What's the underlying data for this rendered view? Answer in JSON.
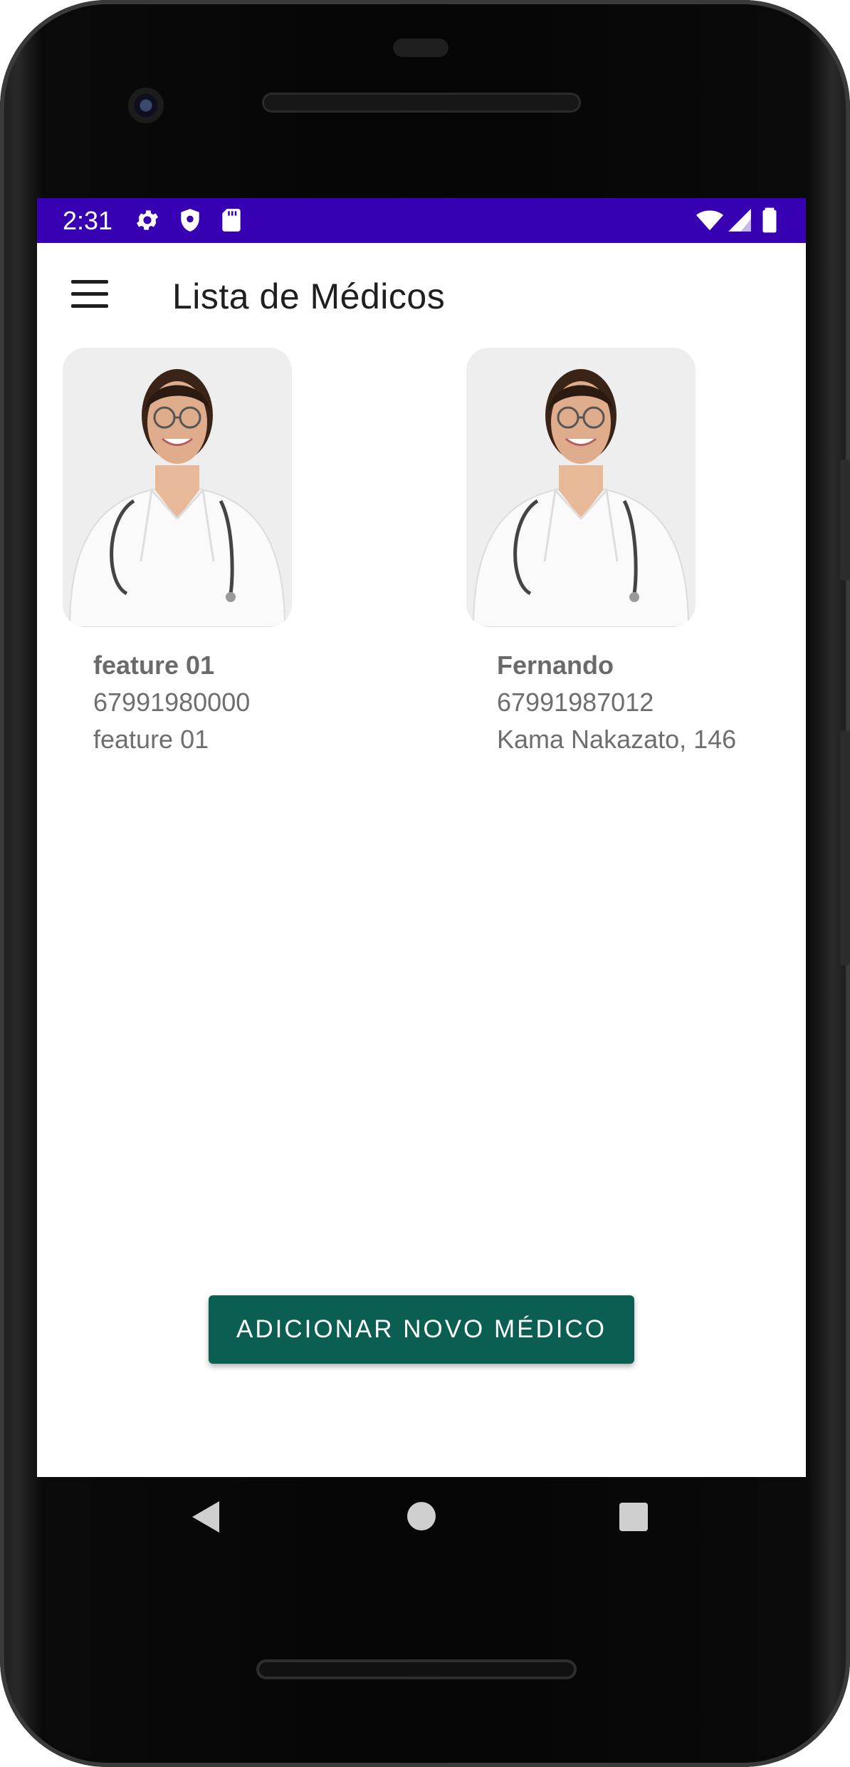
{
  "status_bar": {
    "time": "2:31",
    "left_icons": [
      "gear-icon",
      "shield-icon",
      "sd-card-icon"
    ],
    "right_icons": [
      "wifi-icon",
      "signal-icon",
      "battery-icon"
    ],
    "background_color": "#3700b3"
  },
  "app_bar": {
    "title": "Lista de Médicos",
    "menu_icon": "hamburger-menu-icon"
  },
  "doctors": [
    {
      "name": "feature 01",
      "phone": "67991980000",
      "address": "feature 01"
    },
    {
      "name": "Fernando",
      "phone": "67991987012",
      "address": "Kama Nakazato, 146"
    }
  ],
  "add_button": {
    "label": "ADICIONAR NOVO MÉDICO",
    "color": "#0b5e52"
  },
  "nav_bar": {
    "icons": [
      "back-icon",
      "home-icon",
      "recents-icon"
    ]
  }
}
